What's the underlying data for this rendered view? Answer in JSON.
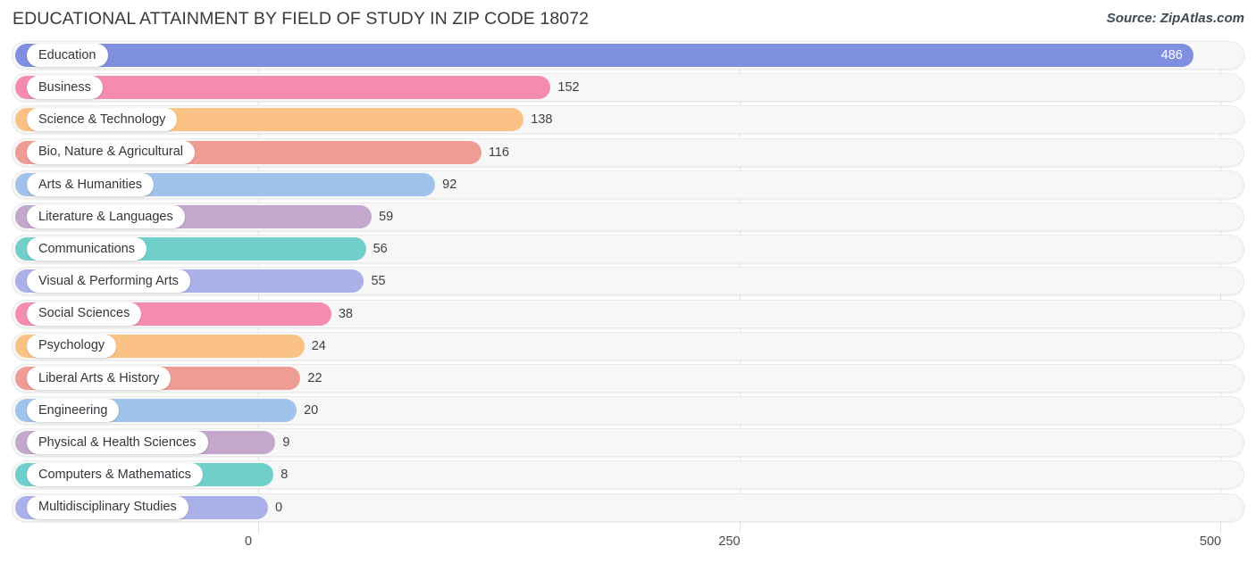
{
  "header": {
    "title": "EDUCATIONAL ATTAINMENT BY FIELD OF STUDY IN ZIP CODE 18072",
    "source": "Source: ZipAtlas.com"
  },
  "chart_data": {
    "type": "bar",
    "orientation": "horizontal",
    "title": "EDUCATIONAL ATTAINMENT BY FIELD OF STUDY IN ZIP CODE 18072",
    "xlabel": "",
    "ylabel": "",
    "xlim": [
      0,
      500
    ],
    "xticks": [
      0,
      250,
      500
    ],
    "xtick_labels": [
      "0",
      "250",
      "500"
    ],
    "grid": true,
    "legend": false,
    "categories": [
      "Education",
      "Business",
      "Science & Technology",
      "Bio, Nature & Agricultural",
      "Arts & Humanities",
      "Literature & Languages",
      "Communications",
      "Visual & Performing Arts",
      "Social Sciences",
      "Psychology",
      "Liberal Arts & History",
      "Engineering",
      "Physical & Health Sciences",
      "Computers & Mathematics",
      "Multidisciplinary Studies"
    ],
    "values": [
      486,
      152,
      138,
      116,
      92,
      59,
      56,
      55,
      38,
      24,
      22,
      20,
      9,
      8,
      0
    ],
    "value_labels": [
      "486",
      "152",
      "138",
      "116",
      "92",
      "59",
      "56",
      "55",
      "38",
      "24",
      "22",
      "20",
      "9",
      "8",
      "0"
    ],
    "colors": [
      "#7f8fe0",
      "#f58bb0",
      "#fbc285",
      "#ef9d94",
      "#9fc3ea",
      "#c3a7cd",
      "#71cfcb",
      "#aab1e8",
      "#f58bb0",
      "#fbc285",
      "#ef9d94",
      "#9fc3ea",
      "#c3a7cd",
      "#71cfcb",
      "#aab1e8"
    ]
  }
}
